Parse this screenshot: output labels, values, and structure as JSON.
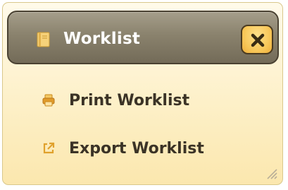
{
  "window": {
    "title": "Worklist"
  },
  "header": {
    "icon": "book-icon",
    "close_icon": "close-icon"
  },
  "menu": {
    "items": [
      {
        "label": "Print Worklist",
        "icon": "printer-icon"
      },
      {
        "label": "Export Worklist",
        "icon": "external-link-icon"
      }
    ]
  },
  "colors": {
    "panel_background": "#fdf0c8",
    "header_background": "#8a826d",
    "header_border": "#4a4232",
    "accent": "#f8c85a",
    "icon_orange": "#e0a62c",
    "text_dark": "#3b3326",
    "title_text": "#ffffff"
  }
}
